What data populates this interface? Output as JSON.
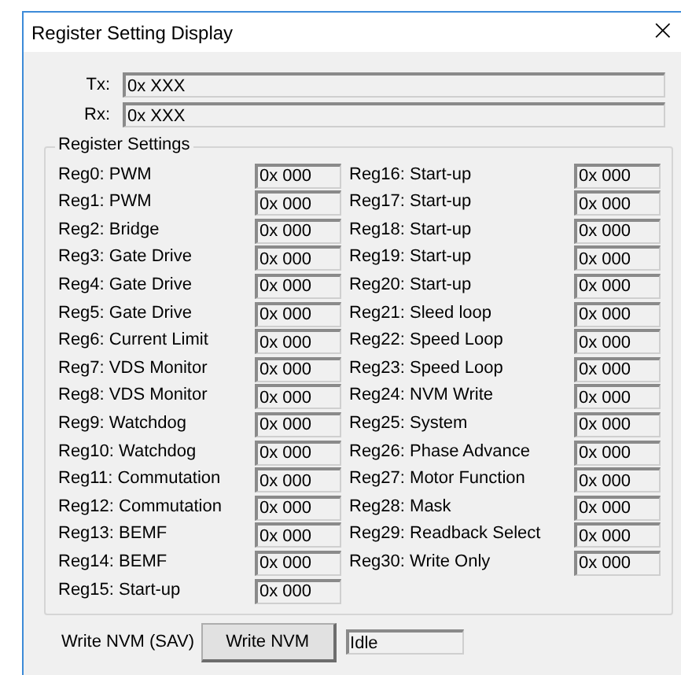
{
  "window": {
    "title": "Register Setting Display",
    "close": "×"
  },
  "tx": {
    "label": "Tx:",
    "value": "0x XXX"
  },
  "rx": {
    "label": "Rx:",
    "value": "0x XXX"
  },
  "register_settings": {
    "title": "Register Settings",
    "columns": [
      [
        {
          "label": "Reg0: PWM",
          "value": "0x 000"
        },
        {
          "label": "Reg1: PWM",
          "value": "0x 000"
        },
        {
          "label": "Reg2: Bridge",
          "value": "0x 000"
        },
        {
          "label": "Reg3: Gate Drive",
          "value": "0x 000"
        },
        {
          "label": "Reg4: Gate Drive",
          "value": "0x 000"
        },
        {
          "label": "Reg5: Gate Drive",
          "value": "0x 000"
        },
        {
          "label": "Reg6: Current Limit",
          "value": "0x 000"
        },
        {
          "label": "Reg7: VDS Monitor",
          "value": "0x 000"
        },
        {
          "label": "Reg8: VDS Monitor",
          "value": "0x 000"
        },
        {
          "label": "Reg9: Watchdog",
          "value": "0x 000"
        },
        {
          "label": "Reg10: Watchdog",
          "value": "0x 000"
        },
        {
          "label": "Reg11: Commutation",
          "value": "0x 000"
        },
        {
          "label": "Reg12: Commutation",
          "value": "0x 000"
        },
        {
          "label": "Reg13: BEMF",
          "value": "0x 000"
        },
        {
          "label": "Reg14: BEMF",
          "value": "0x 000"
        },
        {
          "label": "Reg15: Start-up",
          "value": "0x 000"
        }
      ],
      [
        {
          "label": "Reg16: Start-up",
          "value": "0x 000"
        },
        {
          "label": "Reg17: Start-up",
          "value": "0x 000"
        },
        {
          "label": "Reg18: Start-up",
          "value": "0x 000"
        },
        {
          "label": "Reg19: Start-up",
          "value": "0x 000"
        },
        {
          "label": "Reg20: Start-up",
          "value": "0x 000"
        },
        {
          "label": "Reg21: Sleed loop",
          "value": "0x 000"
        },
        {
          "label": "Reg22: Speed Loop",
          "value": "0x 000"
        },
        {
          "label": "Reg23: Speed Loop",
          "value": "0x 000"
        },
        {
          "label": "Reg24: NVM Write",
          "value": "0x 000"
        },
        {
          "label": "Reg25: System",
          "value": "0x 000"
        },
        {
          "label": "Reg26: Phase Advance",
          "value": "0x 000"
        },
        {
          "label": "Reg27: Motor Function",
          "value": "0x 000"
        },
        {
          "label": "Reg28: Mask",
          "value": "0x 000"
        },
        {
          "label": "Reg29: Readback Select",
          "value": "0x 000"
        },
        {
          "label": "Reg30: Write Only",
          "value": "0x 000"
        }
      ]
    ]
  },
  "footer": {
    "label": "Write NVM (SAV)",
    "button": "Write NVM",
    "status": "Idle"
  }
}
